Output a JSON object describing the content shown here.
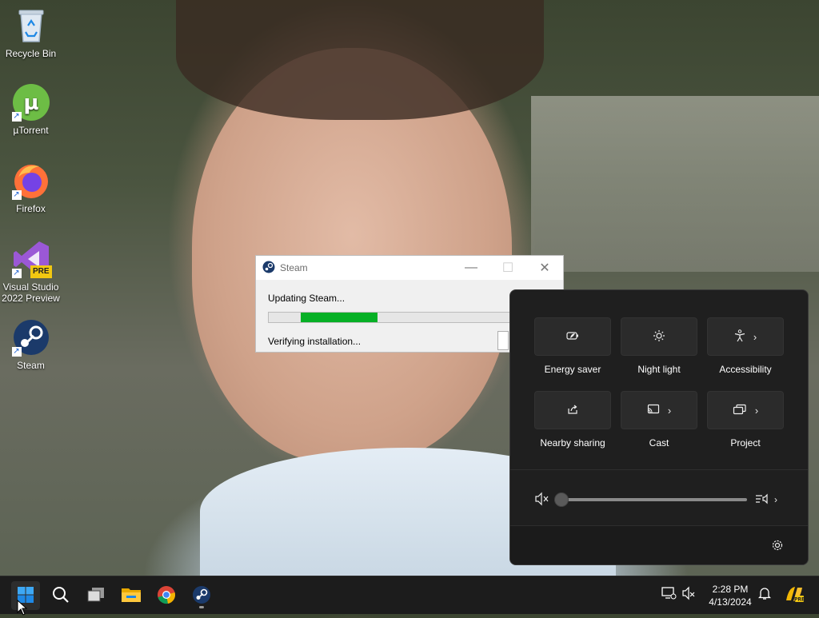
{
  "desktop": {
    "icons": [
      {
        "label": "Recycle Bin",
        "icon": "recycle-bin-icon"
      },
      {
        "label": "µTorrent",
        "icon": "utorrent-icon"
      },
      {
        "label": "Firefox",
        "icon": "firefox-icon"
      },
      {
        "label": "Visual Studio\n2022 Preview",
        "line1": "Visual Studio",
        "line2": "2022 Preview",
        "badge": "PRE",
        "icon": "visual-studio-icon"
      },
      {
        "label": "Steam",
        "icon": "steam-icon"
      }
    ]
  },
  "steam_window": {
    "title": "Steam",
    "status": "Updating Steam...",
    "progress": 0.44,
    "progress_start": 0.13,
    "substatus": "Verifying installation...",
    "accent": "#06b025"
  },
  "quick_settings": {
    "tiles": [
      {
        "label": "Energy saver",
        "icon": "energy-saver-icon",
        "has_chevron": false
      },
      {
        "label": "Night light",
        "icon": "night-light-icon",
        "has_chevron": false
      },
      {
        "label": "Accessibility",
        "icon": "accessibility-icon",
        "has_chevron": true
      },
      {
        "label": "Nearby sharing",
        "icon": "nearby-sharing-icon",
        "has_chevron": false
      },
      {
        "label": "Cast",
        "icon": "cast-icon",
        "has_chevron": true
      },
      {
        "label": "Project",
        "icon": "project-icon",
        "has_chevron": true
      }
    ],
    "volume": {
      "muted": true,
      "level": 0.0
    }
  },
  "taskbar": {
    "apps": [
      "start",
      "search",
      "task-view",
      "file-explorer",
      "chrome",
      "steam"
    ],
    "time": "2:28 PM",
    "date": "4/13/2024"
  }
}
